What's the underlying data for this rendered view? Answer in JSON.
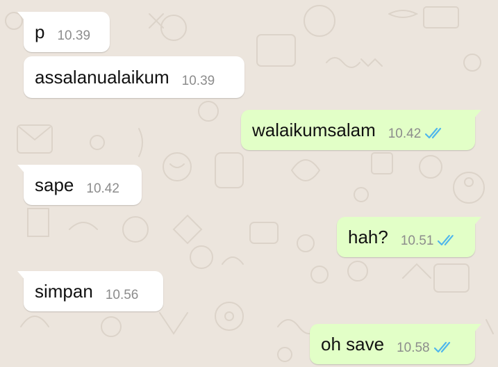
{
  "colors": {
    "background": "#ece5dd",
    "incoming_bubble": "#ffffff",
    "outgoing_bubble": "#e2ffc7",
    "read_ticks": "#4fb6ec",
    "timestamp": "#8c8c8c"
  },
  "messages": [
    {
      "direction": "incoming",
      "text": "p",
      "time": "10.39",
      "status": ""
    },
    {
      "direction": "incoming",
      "text": "assalanualaikum",
      "time": "10.39",
      "status": ""
    },
    {
      "direction": "outgoing",
      "text": "walaikumsalam",
      "time": "10.42",
      "status": "read-ticks-icon"
    },
    {
      "direction": "incoming",
      "text": "sape",
      "time": "10.42",
      "status": ""
    },
    {
      "direction": "outgoing",
      "text": "hah?",
      "time": "10.51",
      "status": "read-ticks-icon"
    },
    {
      "direction": "incoming",
      "text": "simpan",
      "time": "10.56",
      "status": ""
    },
    {
      "direction": "outgoing",
      "text": "oh save",
      "time": "10.58",
      "status": "read-ticks-icon"
    }
  ]
}
